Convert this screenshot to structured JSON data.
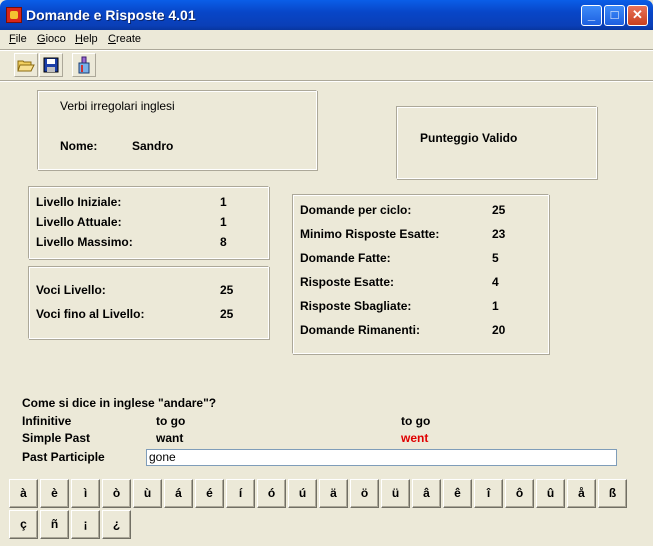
{
  "window": {
    "title": "Domande e Risposte 4.01",
    "min_label": "_",
    "max_label": "□",
    "close_label": "✕"
  },
  "menu": {
    "items": [
      "File",
      "Gioco",
      "Help",
      "Create"
    ]
  },
  "toolbar": {
    "icons": [
      "open-folder-icon",
      "save-disk-icon",
      "create-tool-icon"
    ]
  },
  "info": {
    "subject": "Verbi irregolari inglesi",
    "name_label": "Nome:",
    "name_value": "Sandro"
  },
  "score": {
    "label": "Punteggio Valido"
  },
  "levels": {
    "initial_label": "Livello Iniziale:",
    "initial_value": "1",
    "current_label": "Livello Attuale:",
    "current_value": "1",
    "max_label": "Livello Massimo:",
    "max_value": "8"
  },
  "voices": {
    "level_label": "Voci Livello:",
    "level_value": "25",
    "upto_label": "Voci fino al Livello:",
    "upto_value": "25"
  },
  "stats": {
    "per_cycle_label": "Domande per ciclo:",
    "per_cycle_value": "25",
    "min_correct_label": "Minimo Risposte Esatte:",
    "min_correct_value": "23",
    "asked_label": "Domande Fatte:",
    "asked_value": "5",
    "correct_label": "Risposte Esatte:",
    "correct_value": "4",
    "wrong_label": "Risposte Sbagliate:",
    "wrong_value": "1",
    "remaining_label": "Domande Rimanenti:",
    "remaining_value": "20"
  },
  "question": {
    "prompt": "Come si dice in inglese \"andare\"?",
    "infinitive_label": "Infinitive",
    "infinitive_given": "to go",
    "infinitive_correct": "to go",
    "past_label": "Simple Past",
    "past_given": "want",
    "past_correct": "went",
    "past_correct_color": "#e00000",
    "participle_label": "Past Participle",
    "participle_input": "gone"
  },
  "keyboard": {
    "row1": [
      "à",
      "è",
      "ì",
      "ò",
      "ù",
      "á",
      "é",
      "í",
      "ó",
      "ú",
      "ä",
      "ö",
      "ü",
      "â",
      "ê",
      "î",
      "ô",
      "û",
      "å",
      "ß"
    ],
    "row2": [
      "ç",
      "ñ",
      "¡",
      "¿"
    ]
  }
}
